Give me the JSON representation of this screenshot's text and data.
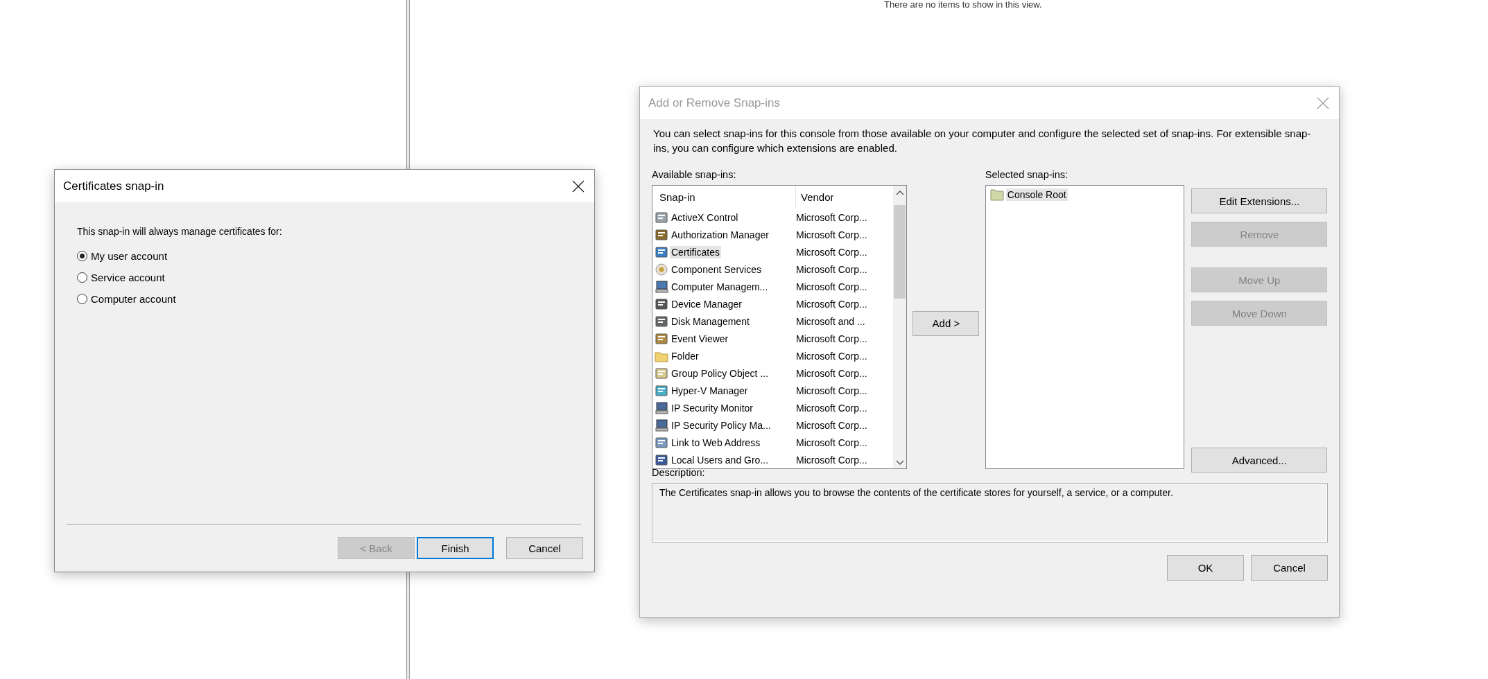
{
  "background_view": {
    "empty_message": "There are no items to show in this view."
  },
  "certificates_dialog": {
    "title": "Certificates snap-in",
    "prompt": "This snap-in will always manage certificates for:",
    "options": [
      {
        "label": "My user account",
        "selected": true
      },
      {
        "label": "Service account",
        "selected": false
      },
      {
        "label": "Computer account",
        "selected": false
      }
    ],
    "buttons": [
      {
        "label": "< Back",
        "disabled": true,
        "default": false
      },
      {
        "label": "Finish",
        "disabled": false,
        "default": true
      },
      {
        "label": "Cancel",
        "disabled": false,
        "default": false
      }
    ]
  },
  "snapins_dialog": {
    "title": "Add or Remove Snap-ins",
    "intro": "You can select snap-ins for this console from those available on your computer and configure the selected set of snap-ins. For extensible snap-ins, you can configure which extensions are enabled.",
    "available": {
      "label": "Available snap-ins:",
      "columns": [
        "Snap-in",
        "Vendor"
      ],
      "rows": [
        {
          "name": "ActiveX Control",
          "vendor": "Microsoft Corp...",
          "selected": false
        },
        {
          "name": "Authorization Manager",
          "vendor": "Microsoft Corp...",
          "selected": false
        },
        {
          "name": "Certificates",
          "vendor": "Microsoft Corp...",
          "selected": true
        },
        {
          "name": "Component Services",
          "vendor": "Microsoft Corp...",
          "selected": false
        },
        {
          "name": "Computer Managem...",
          "vendor": "Microsoft Corp...",
          "selected": false
        },
        {
          "name": "Device Manager",
          "vendor": "Microsoft Corp...",
          "selected": false
        },
        {
          "name": "Disk Management",
          "vendor": "Microsoft and ...",
          "selected": false
        },
        {
          "name": "Event Viewer",
          "vendor": "Microsoft Corp...",
          "selected": false
        },
        {
          "name": "Folder",
          "vendor": "Microsoft Corp...",
          "selected": false
        },
        {
          "name": "Group Policy Object ...",
          "vendor": "Microsoft Corp...",
          "selected": false
        },
        {
          "name": "Hyper-V Manager",
          "vendor": "Microsoft Corp...",
          "selected": false
        },
        {
          "name": "IP Security Monitor",
          "vendor": "Microsoft Corp...",
          "selected": false
        },
        {
          "name": "IP Security Policy Ma...",
          "vendor": "Microsoft Corp...",
          "selected": false
        },
        {
          "name": "Link to Web Address",
          "vendor": "Microsoft Corp...",
          "selected": false
        },
        {
          "name": "Local Users and Gro...",
          "vendor": "Microsoft Corp...",
          "selected": false
        }
      ]
    },
    "add_button": "Add >",
    "selected": {
      "label": "Selected snap-ins:",
      "items": [
        {
          "name": "Console Root",
          "selected": true
        }
      ]
    },
    "side_buttons": [
      {
        "label": "Edit Extensions...",
        "disabled": false
      },
      {
        "label": "Remove",
        "disabled": true
      },
      {
        "label": "Move Up",
        "disabled": true
      },
      {
        "label": "Move Down",
        "disabled": true
      },
      {
        "label": "Advanced...",
        "disabled": false
      }
    ],
    "description": {
      "label": "Description:",
      "text": "The Certificates snap-in allows you to browse the contents of the certificate stores for yourself, a service, or a computer."
    },
    "buttons": [
      {
        "label": "OK"
      },
      {
        "label": "Cancel"
      }
    ]
  }
}
